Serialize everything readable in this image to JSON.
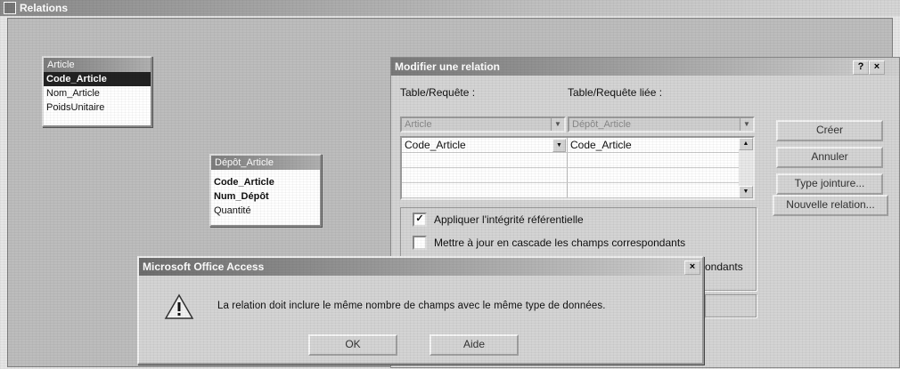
{
  "window": {
    "title": "Relations"
  },
  "tables": [
    {
      "title": "Article",
      "fields": [
        "Code_Article",
        "Nom_Article",
        "PoidsUnitaire"
      ]
    },
    {
      "title": "Dépôt_Article",
      "fields": [
        "Code_Article",
        "Num_Dépôt",
        "Quantité"
      ]
    }
  ],
  "edit_dialog": {
    "title": "Modifier une relation",
    "help_button": "?",
    "close_button": "×",
    "label_table": "Table/Requête :",
    "label_related": "Table/Requête liée :",
    "table_value": "Article",
    "related_value": "Dépôt_Article",
    "grid_rows": [
      {
        "left": "Code_Article",
        "right": "Code_Article"
      },
      {
        "left": "",
        "right": ""
      },
      {
        "left": "",
        "right": ""
      },
      {
        "left": "",
        "right": ""
      }
    ],
    "buttons": {
      "create": "Créer",
      "cancel": "Annuler",
      "join_type": "Type jointure...",
      "new_relation": "Nouvelle relation..."
    },
    "checks": {
      "integrity": {
        "label": "Appliquer l'intégrité référentielle",
        "checked": true
      },
      "cascade_update": {
        "label": "Mettre à jour en cascade les champs correspondants",
        "checked": false
      },
      "cascade_delete_partial": "ondants"
    }
  },
  "error_dialog": {
    "title": "Microsoft Office Access",
    "close": "×",
    "icon": "warning-icon",
    "message": "La relation doit inclure le même nombre de champs avec le même type de données.",
    "ok": "OK",
    "help": "Aide"
  }
}
